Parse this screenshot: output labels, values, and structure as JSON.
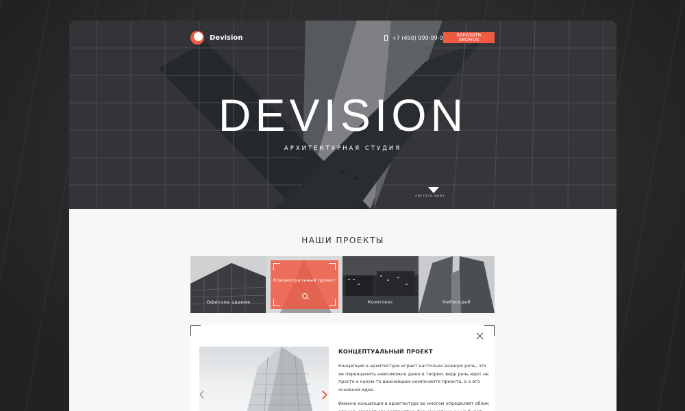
{
  "header": {
    "logo_text": "Devision",
    "phone": "+7 (450) 999-99-99",
    "call_button": "ЗАКАЗАТЬ ЗВОНОК"
  },
  "hero": {
    "title": "DEVISION",
    "subtitle": "АРХИТЕКТУРНАЯ СТУДИЯ",
    "scroll_label": "листать вниз"
  },
  "projects": {
    "title": "НАШИ ПРОЕКТЫ",
    "tiles": [
      {
        "label": "Офисное здание"
      },
      {
        "label": "Концептуальный проект",
        "active": true
      },
      {
        "label": "Комплекс"
      },
      {
        "label": "Небоскреб"
      }
    ]
  },
  "detail": {
    "title": "КОНЦЕПТУАЛЬНЫЙ ПРОЕКТ",
    "paragraphs": [
      "Концепция в архитектуре играет настолько важную роль, что ее переоценить невозможно даже в теории, ведь речь идет не просто о каком-то важнейшем компоненте проекта, а о его основной идее.",
      "Именно концепция в архитектуре во многом определяет облик здания, создает его восприятие, без концепции он не будет"
    ]
  },
  "colors": {
    "accent": "#ef5a43",
    "page_bg": "#2c2c2c",
    "content_bg": "#f7f7f7"
  }
}
